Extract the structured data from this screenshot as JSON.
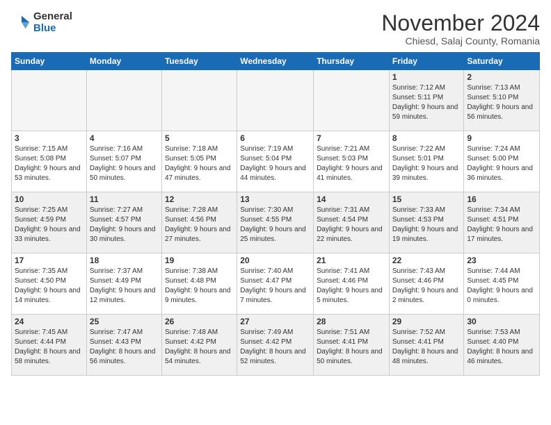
{
  "logo": {
    "general": "General",
    "blue": "Blue"
  },
  "header": {
    "month": "November 2024",
    "location": "Chiesd, Salaj County, Romania"
  },
  "weekdays": [
    "Sunday",
    "Monday",
    "Tuesday",
    "Wednesday",
    "Thursday",
    "Friday",
    "Saturday"
  ],
  "weeks": [
    [
      {
        "day": "",
        "empty": true
      },
      {
        "day": "",
        "empty": true
      },
      {
        "day": "",
        "empty": true
      },
      {
        "day": "",
        "empty": true
      },
      {
        "day": "",
        "empty": true
      },
      {
        "day": "1",
        "sunrise": "7:12 AM",
        "sunset": "5:11 PM",
        "daylight": "9 hours and 59 minutes."
      },
      {
        "day": "2",
        "sunrise": "7:13 AM",
        "sunset": "5:10 PM",
        "daylight": "9 hours and 56 minutes."
      }
    ],
    [
      {
        "day": "3",
        "sunrise": "7:15 AM",
        "sunset": "5:08 PM",
        "daylight": "9 hours and 53 minutes."
      },
      {
        "day": "4",
        "sunrise": "7:16 AM",
        "sunset": "5:07 PM",
        "daylight": "9 hours and 50 minutes."
      },
      {
        "day": "5",
        "sunrise": "7:18 AM",
        "sunset": "5:05 PM",
        "daylight": "9 hours and 47 minutes."
      },
      {
        "day": "6",
        "sunrise": "7:19 AM",
        "sunset": "5:04 PM",
        "daylight": "9 hours and 44 minutes."
      },
      {
        "day": "7",
        "sunrise": "7:21 AM",
        "sunset": "5:03 PM",
        "daylight": "9 hours and 41 minutes."
      },
      {
        "day": "8",
        "sunrise": "7:22 AM",
        "sunset": "5:01 PM",
        "daylight": "9 hours and 39 minutes."
      },
      {
        "day": "9",
        "sunrise": "7:24 AM",
        "sunset": "5:00 PM",
        "daylight": "9 hours and 36 minutes."
      }
    ],
    [
      {
        "day": "10",
        "sunrise": "7:25 AM",
        "sunset": "4:59 PM",
        "daylight": "9 hours and 33 minutes."
      },
      {
        "day": "11",
        "sunrise": "7:27 AM",
        "sunset": "4:57 PM",
        "daylight": "9 hours and 30 minutes."
      },
      {
        "day": "12",
        "sunrise": "7:28 AM",
        "sunset": "4:56 PM",
        "daylight": "9 hours and 27 minutes."
      },
      {
        "day": "13",
        "sunrise": "7:30 AM",
        "sunset": "4:55 PM",
        "daylight": "9 hours and 25 minutes."
      },
      {
        "day": "14",
        "sunrise": "7:31 AM",
        "sunset": "4:54 PM",
        "daylight": "9 hours and 22 minutes."
      },
      {
        "day": "15",
        "sunrise": "7:33 AM",
        "sunset": "4:53 PM",
        "daylight": "9 hours and 19 minutes."
      },
      {
        "day": "16",
        "sunrise": "7:34 AM",
        "sunset": "4:51 PM",
        "daylight": "9 hours and 17 minutes."
      }
    ],
    [
      {
        "day": "17",
        "sunrise": "7:35 AM",
        "sunset": "4:50 PM",
        "daylight": "9 hours and 14 minutes."
      },
      {
        "day": "18",
        "sunrise": "7:37 AM",
        "sunset": "4:49 PM",
        "daylight": "9 hours and 12 minutes."
      },
      {
        "day": "19",
        "sunrise": "7:38 AM",
        "sunset": "4:48 PM",
        "daylight": "9 hours and 9 minutes."
      },
      {
        "day": "20",
        "sunrise": "7:40 AM",
        "sunset": "4:47 PM",
        "daylight": "9 hours and 7 minutes."
      },
      {
        "day": "21",
        "sunrise": "7:41 AM",
        "sunset": "4:46 PM",
        "daylight": "9 hours and 5 minutes."
      },
      {
        "day": "22",
        "sunrise": "7:43 AM",
        "sunset": "4:46 PM",
        "daylight": "9 hours and 2 minutes."
      },
      {
        "day": "23",
        "sunrise": "7:44 AM",
        "sunset": "4:45 PM",
        "daylight": "9 hours and 0 minutes."
      }
    ],
    [
      {
        "day": "24",
        "sunrise": "7:45 AM",
        "sunset": "4:44 PM",
        "daylight": "8 hours and 58 minutes."
      },
      {
        "day": "25",
        "sunrise": "7:47 AM",
        "sunset": "4:43 PM",
        "daylight": "8 hours and 56 minutes."
      },
      {
        "day": "26",
        "sunrise": "7:48 AM",
        "sunset": "4:42 PM",
        "daylight": "8 hours and 54 minutes."
      },
      {
        "day": "27",
        "sunrise": "7:49 AM",
        "sunset": "4:42 PM",
        "daylight": "8 hours and 52 minutes."
      },
      {
        "day": "28",
        "sunrise": "7:51 AM",
        "sunset": "4:41 PM",
        "daylight": "8 hours and 50 minutes."
      },
      {
        "day": "29",
        "sunrise": "7:52 AM",
        "sunset": "4:41 PM",
        "daylight": "8 hours and 48 minutes."
      },
      {
        "day": "30",
        "sunrise": "7:53 AM",
        "sunset": "4:40 PM",
        "daylight": "8 hours and 46 minutes."
      }
    ]
  ],
  "labels": {
    "sunrise": "Sunrise:",
    "sunset": "Sunset:",
    "daylight": "Daylight:"
  }
}
